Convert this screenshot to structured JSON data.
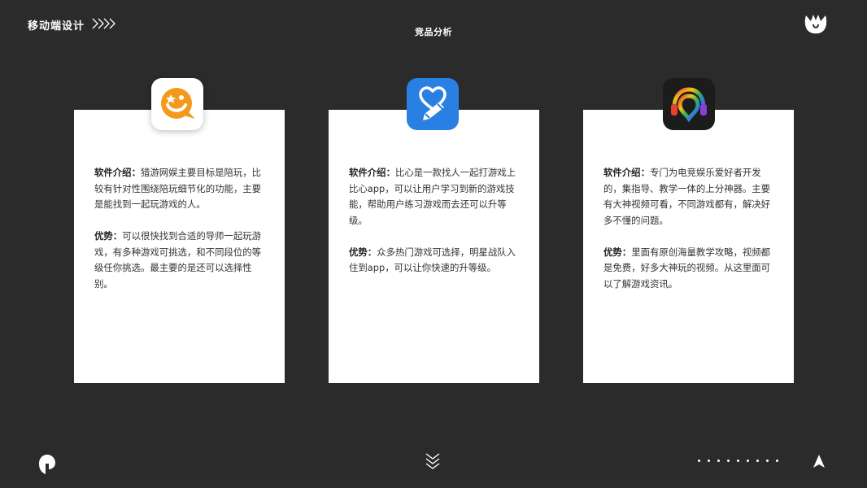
{
  "header": {
    "brand": "移动端设计",
    "page_title": "竞品分析"
  },
  "cards": [
    {
      "app_icon": "orange-chat-icon",
      "intro_label": "软件介绍：",
      "intro_text": "猎游网娱主要目标是陪玩，比较有针对性围绕陪玩细节化的功能，主要是能找到一起玩游戏的人。",
      "adv_label": "优势：",
      "adv_text": "可以很快找到合适的导师一起玩游戏，有多种游戏可挑选，和不同段位的等级任你挑选。最主要的是还可以选择性别。"
    },
    {
      "app_icon": "heart-pencil-icon",
      "intro_label": "软件介绍：",
      "intro_text": "比心是一款找人一起打游戏上比心app，可以让用户学习到新的游戏技能，帮助用户练习游戏而去还可以升等级。",
      "adv_label": "优势：",
      "adv_text": "众多热门游戏可选择，明星战队入住到app，可以让你快速的升等级。"
    },
    {
      "app_icon": "rainbow-headphones-icon",
      "intro_label": "软件介绍：",
      "intro_text": "专门为电竞娱乐爱好者开发的，集指导、教学一体的上分神器。主要有大神视频可看，不同游戏都有，解决好多不懂的问题。",
      "adv_label": "优势：",
      "adv_text": "里面有原创海量教学攻略，视频都是免费，好多大神玩的视频。从这里面可以了解游戏资讯。"
    }
  ],
  "footer": {
    "dot_count": 9
  },
  "colors": {
    "background": "#2b2b2b",
    "card": "#ffffff",
    "text": "#333333",
    "orange": "#f39a1e",
    "blue": "#2a7fe3"
  }
}
